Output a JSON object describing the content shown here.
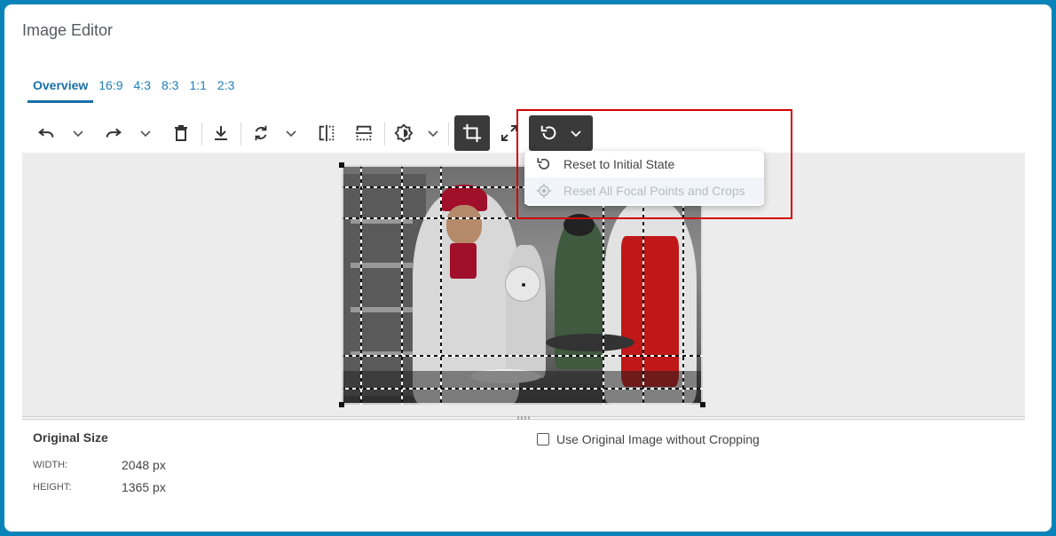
{
  "title": "Image Editor",
  "tabs": [
    {
      "label": "Overview",
      "active": true
    },
    {
      "label": "16:9"
    },
    {
      "label": "4:3"
    },
    {
      "label": "8:3"
    },
    {
      "label": "1:1"
    },
    {
      "label": "2:3"
    }
  ],
  "toolbar": {
    "icons": [
      "undo-icon",
      "redo-icon",
      "delete-icon",
      "download-icon",
      "rotate-icon",
      "flip-horizontal-icon",
      "flip-vertical-icon",
      "filter-icon",
      "crop-icon",
      "expand-icon",
      "reset-icon"
    ]
  },
  "dropdown": {
    "items": [
      {
        "label": "Reset to Initial State",
        "icon": "reset-icon",
        "disabled": false
      },
      {
        "label": "Reset All Focal Points and Crops",
        "icon": "focal-point-icon",
        "disabled": true
      }
    ]
  },
  "info": {
    "title": "Original Size",
    "width_label": "WIDTH:",
    "width_value": "2048 px",
    "height_label": "HEIGHT:",
    "height_value": "1365 px"
  },
  "checkbox": {
    "label": "Use Original Image without Cropping",
    "checked": false
  },
  "colors": {
    "accent": "#1a6fa5",
    "frame": "#0a84b8",
    "highlight": "#d40000"
  }
}
